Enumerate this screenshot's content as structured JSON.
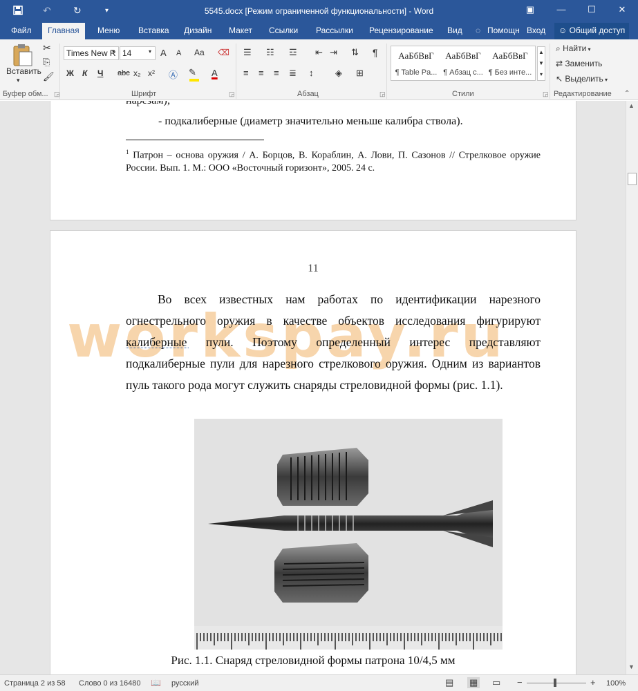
{
  "window": {
    "title": "5545.docx [Режим ограниченной функциональности] - Word",
    "controls": {
      "ribbon_display": "▣",
      "minimize": "—",
      "maximize": "☐",
      "close": "✕"
    }
  },
  "quick_access": {
    "save_icon": "save-icon",
    "undo_icon": "undo-icon",
    "redo_icon": "redo-icon",
    "customize_icon": "customize-icon"
  },
  "tabs": [
    "Файл",
    "Главная",
    "Меню",
    "Вставка",
    "Дизайн",
    "Макет",
    "Ссылки",
    "Рассылки",
    "Рецензирование",
    "Вид"
  ],
  "tell_me": "Помощн",
  "sign_in": "Вход",
  "share": "Общий доступ",
  "ribbon": {
    "clipboard": {
      "paste_label": "Вставить",
      "group_label": "Буфер обм..."
    },
    "font": {
      "font_name": "Times New R",
      "font_size": "14",
      "group_label": "Шрифт",
      "grow": "A",
      "shrink": "A",
      "case": "Aa",
      "bold": "Ж",
      "italic": "К",
      "underline": "Ч",
      "strike": "abc",
      "sub": "x₂",
      "sup": "x²"
    },
    "paragraph": {
      "group_label": "Абзац",
      "pilcrow": "¶"
    },
    "styles": {
      "group_label": "Стили",
      "items": [
        {
          "sample": "АаБбВвГ",
          "label": "¶ Table Pa..."
        },
        {
          "sample": "АаБбВвГ",
          "label": "¶ Абзац с..."
        },
        {
          "sample": "АаБбВвГ",
          "label": "¶ Без инте..."
        }
      ]
    },
    "editing": {
      "group_label": "Редактирование",
      "find": "Найти",
      "replace": "Заменить",
      "select": "Выделить"
    }
  },
  "document": {
    "page1": {
      "cut_text": "нарезам);",
      "bullet_line": "- подкалиберные (диаметр значительно меньше калибра ствола).",
      "footnote_num": "1",
      "footnote_text": "Патрон – основа оружия / А. Борцов, В. Кораблин, А. Лови, П. Сазонов // Стрелковое оружие России. Вып. 1. М.: ООО «Восточный горизонт», 2005. 24 с."
    },
    "page2": {
      "page_number": "11",
      "para_lines": [
        "Во всех известных нам работах по идентификации нарезного",
        "огнестрельного оружия в качестве объектов исследования фигурируют",
        "калиберные пули. Поэтому определенный интерес представляют",
        "подкалиберные пули для нарезного стрелкового оружия. Одним из вариантов",
        "пуль такого рода могут служить снаряды стреловидной формы (рис. 1.1)."
      ],
      "watermark": "workspay.ru",
      "caption": "Рис. 1.1. Снаряд стреловидной формы патрона 10/4,5 мм"
    }
  },
  "status": {
    "page": "Страница 2 из 58",
    "words": "Слово 0 из 16480",
    "language": "русский",
    "zoom": "100%"
  },
  "colors": {
    "accent": "#2b579a",
    "watermark": "#f2b36a"
  }
}
